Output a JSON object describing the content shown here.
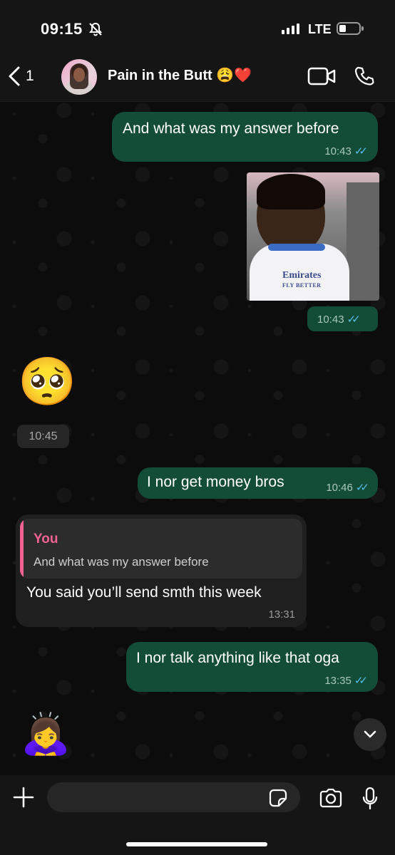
{
  "status_bar": {
    "time": "09:15",
    "network": "LTE"
  },
  "header": {
    "back_count": "1",
    "chat_name": "Pain in the Butt",
    "name_emojis": "😩❤️"
  },
  "messages": {
    "m1": {
      "text": "And what was my answer before",
      "time": "10:43"
    },
    "m2": {
      "time": "10:43",
      "photo_text_1": "Emirates",
      "photo_text_2": "FLY BETTER"
    },
    "m3": {
      "emoji": "🥺",
      "time": "10:45"
    },
    "m4": {
      "text": "I nor get money bros",
      "time": "10:46"
    },
    "m5": {
      "quote_author": "You",
      "quote_text": "And what was my answer before",
      "text": "You said you’ll send smth this week",
      "time": "13:31"
    },
    "m6": {
      "text": "I nor talk anything like that oga",
      "time": "13:35"
    },
    "m7": {
      "emoji": "🙇‍♀️"
    }
  },
  "input": {
    "placeholder": ""
  },
  "colors": {
    "outgoing_bubble": "#144d37",
    "incoming_bubble": "#1f1f1f",
    "read_ticks": "#53bdeb",
    "quote_accent": "#f06292"
  }
}
